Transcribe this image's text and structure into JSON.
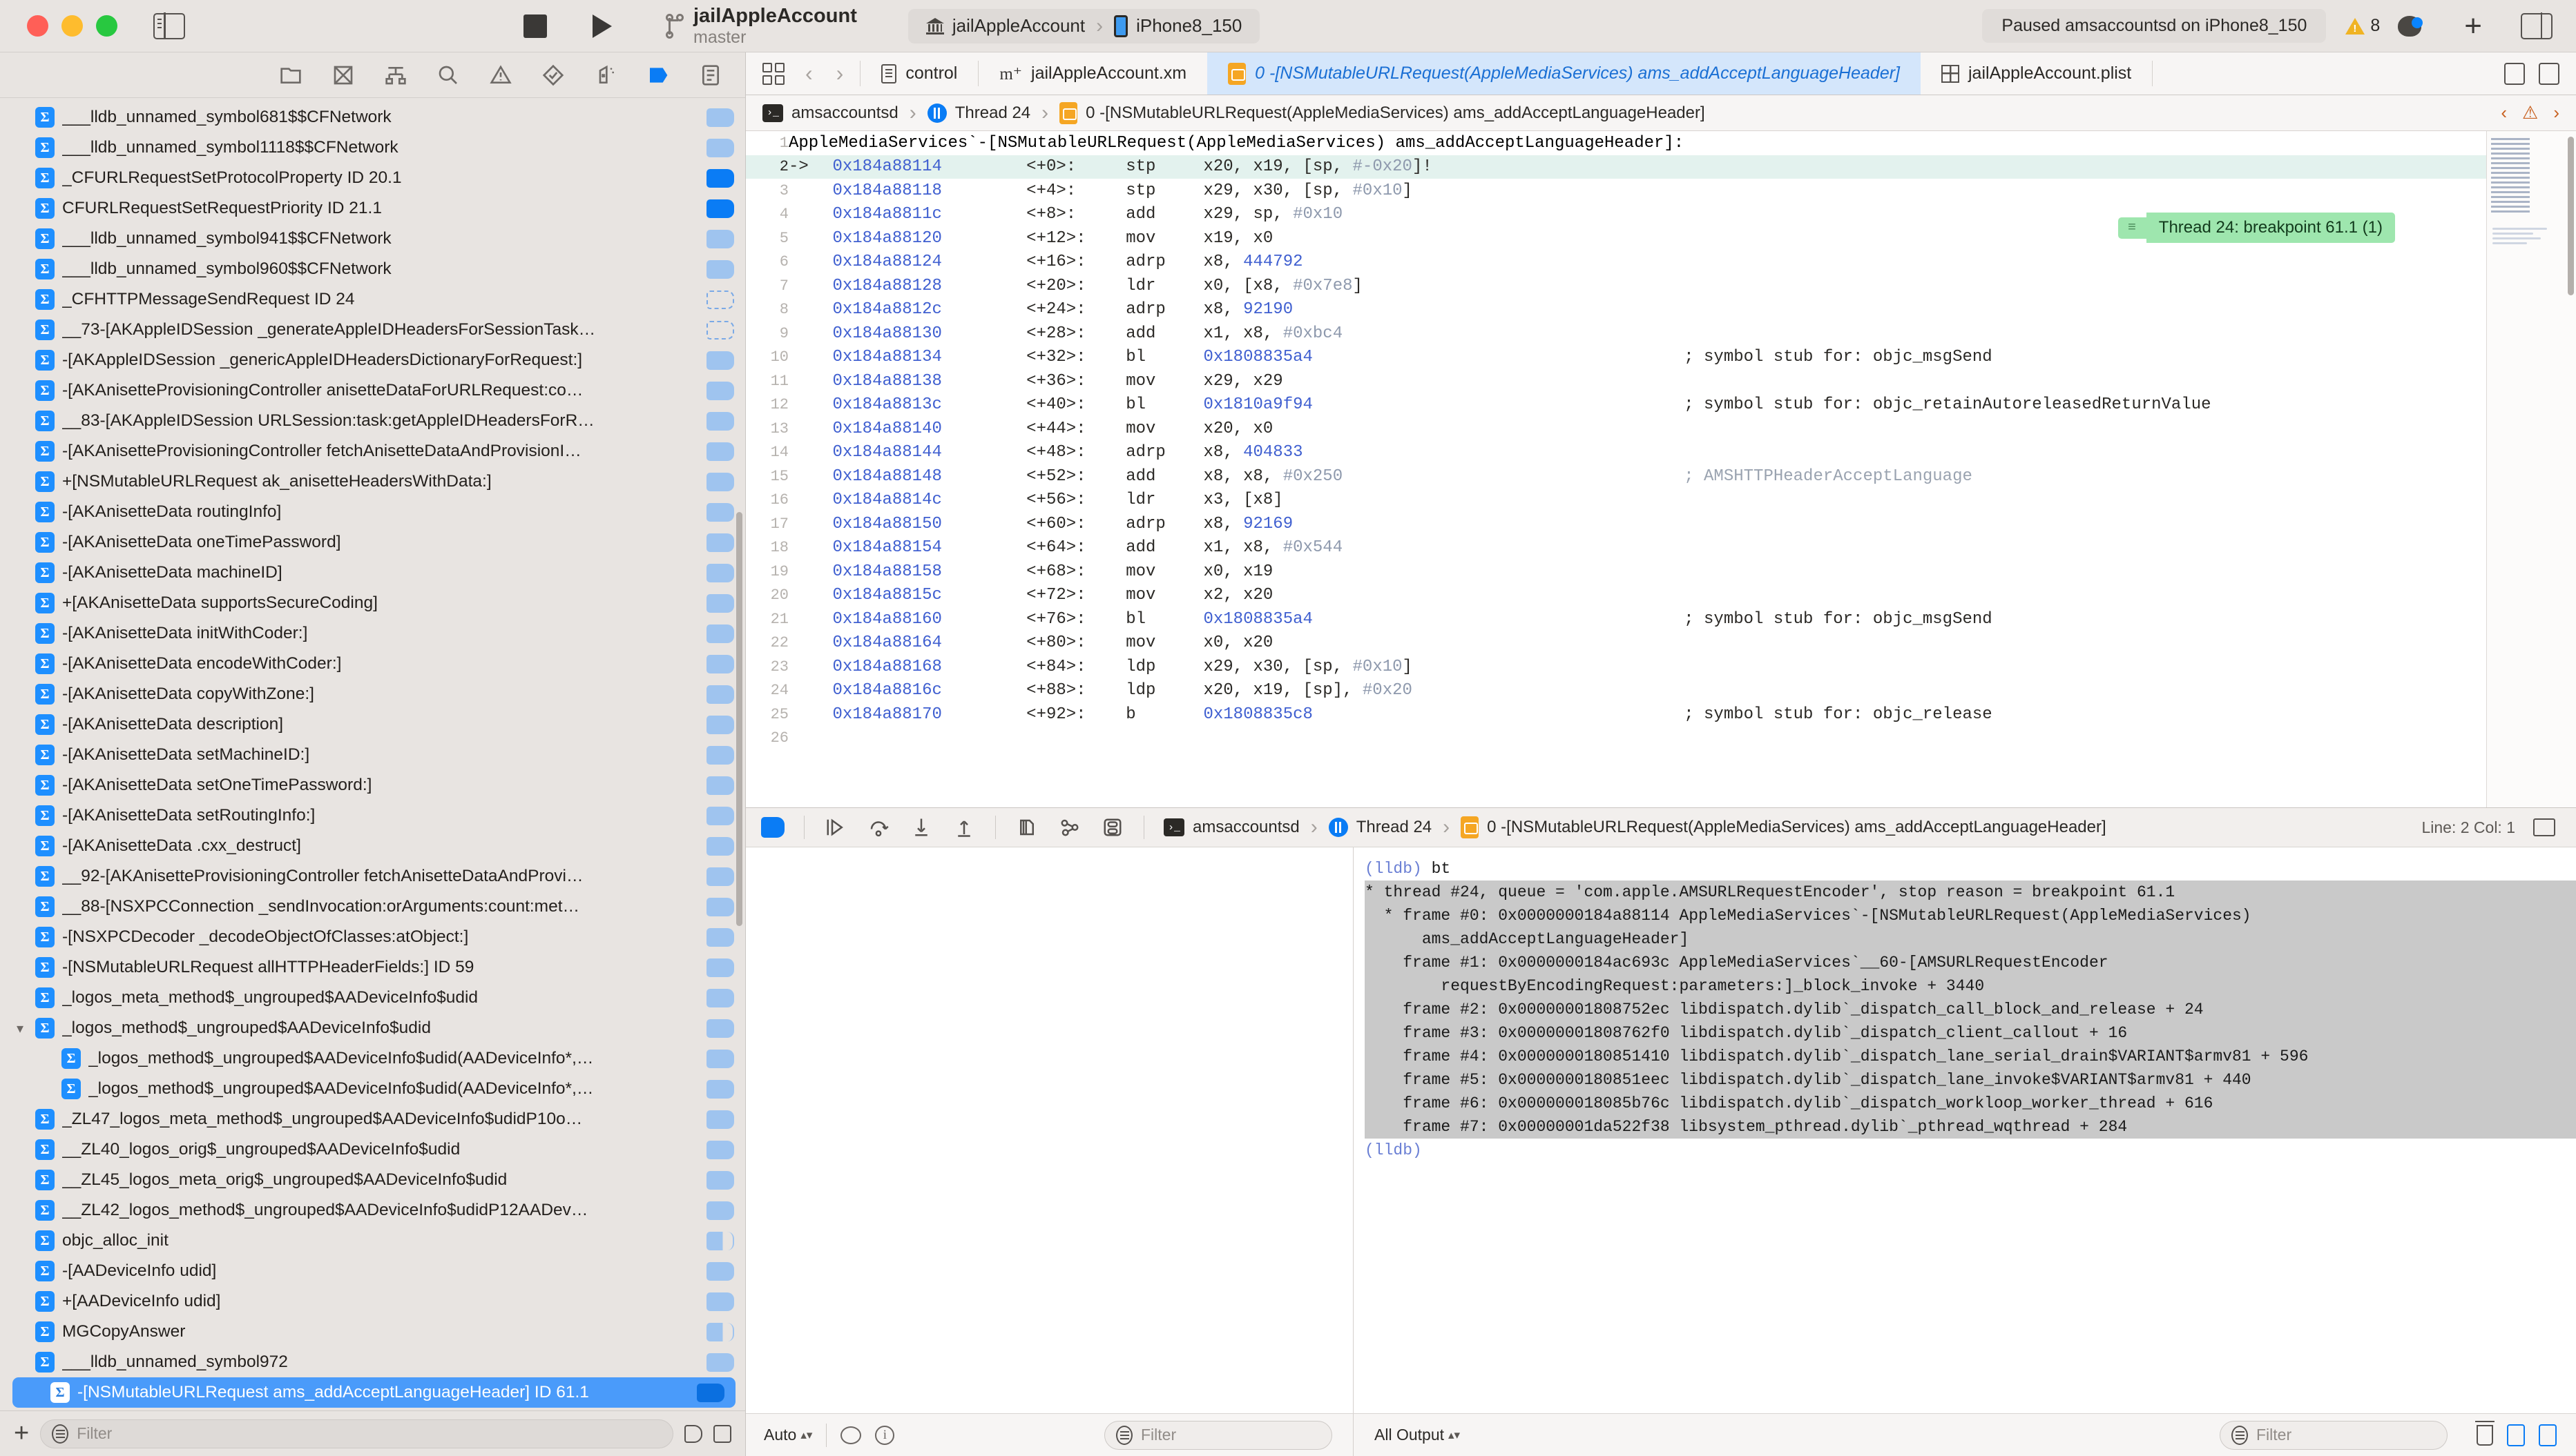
{
  "titlebar": {
    "project_name": "jailAppleAccount",
    "branch": "master",
    "scheme_target": "jailAppleAccount",
    "scheme_device": "iPhone8_150",
    "status": "Paused amsaccountsd on iPhone8_150",
    "warning_count": "8"
  },
  "navigator": {
    "filter_placeholder": "Filter",
    "items": [
      {
        "label": "___lldb_unnamed_symbol681$$CFNetwork",
        "badge": "dim",
        "indent": 0,
        "tri": ""
      },
      {
        "label": "___lldb_unnamed_symbol1118$$CFNetwork",
        "badge": "dim",
        "indent": 0,
        "tri": ""
      },
      {
        "label": "_CFURLRequestSetProtocolProperty  ID 20.1",
        "badge": "on",
        "indent": 0,
        "tri": ""
      },
      {
        "label": "CFURLRequestSetRequestPriority  ID 21.1",
        "badge": "on",
        "indent": 0,
        "tri": ""
      },
      {
        "label": "___lldb_unnamed_symbol941$$CFNetwork",
        "badge": "dim",
        "indent": 0,
        "tri": ""
      },
      {
        "label": "___lldb_unnamed_symbol960$$CFNetwork",
        "badge": "dim",
        "indent": 0,
        "tri": ""
      },
      {
        "label": "_CFHTTPMessageSendRequest ID 24",
        "badge": "off",
        "indent": 0,
        "tri": ""
      },
      {
        "label": "__73-[AKAppleIDSession _generateAppleIDHeadersForSessionTask…",
        "badge": "off",
        "indent": 0,
        "tri": ""
      },
      {
        "label": "-[AKAppleIDSession _genericAppleIDHeadersDictionaryForRequest:]",
        "badge": "dim",
        "indent": 0,
        "tri": ""
      },
      {
        "label": "-[AKAnisetteProvisioningController anisetteDataForURLRequest:co…",
        "badge": "dim",
        "indent": 0,
        "tri": ""
      },
      {
        "label": "__83-[AKAppleIDSession URLSession:task:getAppleIDHeadersForR…",
        "badge": "dim",
        "indent": 0,
        "tri": ""
      },
      {
        "label": "-[AKAnisetteProvisioningController fetchAnisetteDataAndProvisionI…",
        "badge": "dim",
        "indent": 0,
        "tri": ""
      },
      {
        "label": "+[NSMutableURLRequest ak_anisetteHeadersWithData:]",
        "badge": "dim",
        "indent": 0,
        "tri": ""
      },
      {
        "label": "-[AKAnisetteData routingInfo]",
        "badge": "dim",
        "indent": 0,
        "tri": ""
      },
      {
        "label": "-[AKAnisetteData oneTimePassword]",
        "badge": "dim",
        "indent": 0,
        "tri": ""
      },
      {
        "label": "-[AKAnisetteData machineID]",
        "badge": "dim",
        "indent": 0,
        "tri": ""
      },
      {
        "label": "+[AKAnisetteData supportsSecureCoding]",
        "badge": "dim",
        "indent": 0,
        "tri": ""
      },
      {
        "label": "-[AKAnisetteData initWithCoder:]",
        "badge": "dim",
        "indent": 0,
        "tri": ""
      },
      {
        "label": "-[AKAnisetteData encodeWithCoder:]",
        "badge": "dim",
        "indent": 0,
        "tri": ""
      },
      {
        "label": "-[AKAnisetteData copyWithZone:]",
        "badge": "dim",
        "indent": 0,
        "tri": ""
      },
      {
        "label": "-[AKAnisetteData description]",
        "badge": "dim",
        "indent": 0,
        "tri": ""
      },
      {
        "label": "-[AKAnisetteData setMachineID:]",
        "badge": "dim",
        "indent": 0,
        "tri": ""
      },
      {
        "label": "-[AKAnisetteData setOneTimePassword:]",
        "badge": "dim",
        "indent": 0,
        "tri": ""
      },
      {
        "label": "-[AKAnisetteData setRoutingInfo:]",
        "badge": "dim",
        "indent": 0,
        "tri": ""
      },
      {
        "label": "-[AKAnisetteData .cxx_destruct]",
        "badge": "dim",
        "indent": 0,
        "tri": ""
      },
      {
        "label": "__92-[AKAnisetteProvisioningController fetchAnisetteDataAndProvi…",
        "badge": "dim",
        "indent": 0,
        "tri": ""
      },
      {
        "label": "__88-[NSXPCConnection _sendInvocation:orArguments:count:met…",
        "badge": "dim",
        "indent": 0,
        "tri": ""
      },
      {
        "label": "-[NSXPCDecoder _decodeObjectOfClasses:atObject:]",
        "badge": "dim",
        "indent": 0,
        "tri": ""
      },
      {
        "label": "-[NSMutableURLRequest allHTTPHeaderFields:] ID 59",
        "badge": "dim",
        "indent": 0,
        "tri": ""
      },
      {
        "label": "_logos_meta_method$_ungrouped$AADeviceInfo$udid",
        "badge": "dim",
        "indent": 0,
        "tri": ""
      },
      {
        "label": "_logos_method$_ungrouped$AADeviceInfo$udid",
        "badge": "dim",
        "indent": 0,
        "tri": "v"
      },
      {
        "label": "_logos_method$_ungrouped$AADeviceInfo$udid(AADeviceInfo*,…",
        "badge": "dim",
        "indent": 1,
        "tri": ""
      },
      {
        "label": "_logos_method$_ungrouped$AADeviceInfo$udid(AADeviceInfo*,…",
        "badge": "dim",
        "indent": 1,
        "tri": ""
      },
      {
        "label": "_ZL47_logos_meta_method$_ungrouped$AADeviceInfo$udidP10o…",
        "badge": "dim",
        "indent": 0,
        "tri": ""
      },
      {
        "label": "__ZL40_logos_orig$_ungrouped$AADeviceInfo$udid",
        "badge": "dim",
        "indent": 0,
        "tri": ""
      },
      {
        "label": "__ZL45_logos_meta_orig$_ungrouped$AADeviceInfo$udid",
        "badge": "dim",
        "indent": 0,
        "tri": ""
      },
      {
        "label": "__ZL42_logos_method$_ungrouped$AADeviceInfo$udidP12AADev…",
        "badge": "dim",
        "indent": 0,
        "tri": ""
      },
      {
        "label": "objc_alloc_init",
        "badge": "half",
        "indent": 0,
        "tri": ""
      },
      {
        "label": "-[AADeviceInfo udid]",
        "badge": "dim",
        "indent": 0,
        "tri": ""
      },
      {
        "label": "+[AADeviceInfo udid]",
        "badge": "dim",
        "indent": 0,
        "tri": ""
      },
      {
        "label": "MGCopyAnswer",
        "badge": "half",
        "indent": 0,
        "tri": ""
      },
      {
        "label": "___lldb_unnamed_symbol972",
        "badge": "dim",
        "indent": 0,
        "tri": ""
      },
      {
        "label": "-[NSMutableURLRequest ams_addAcceptLanguageHeader]  ID 61.1",
        "badge": "on",
        "indent": 0,
        "tri": "",
        "selected": true
      }
    ]
  },
  "editor": {
    "tabs": [
      {
        "label": "control",
        "icon": "document-icon",
        "active": false
      },
      {
        "label": "jailAppleAccount.xm",
        "icon": "m-file-icon",
        "active": false
      },
      {
        "label": "0 -[NSMutableURLRequest(AppleMediaServices) ams_addAcceptLanguageHeader]",
        "icon": "breakpoint-icon",
        "active": true
      },
      {
        "label": "jailAppleAccount.plist",
        "icon": "plist-icon",
        "active": false
      }
    ],
    "jumpbar": {
      "process": "amsaccountsd",
      "thread": "Thread 24",
      "frame": "0 -[NSMutableURLRequest(AppleMediaServices) ams_addAcceptLanguageHeader]"
    },
    "breakpoint_annotation": "Thread 24: breakpoint 61.1 (1)",
    "header_line": "AppleMediaServices`-[NSMutableURLRequest(AppleMediaServices) ams_addAcceptLanguageHeader]:",
    "lines": [
      {
        "n": "1",
        "header": "AppleMediaServices`-[NSMutableURLRequest(AppleMediaServices) ams_addAcceptLanguageHeader]:"
      },
      {
        "n": "2",
        "arrow": "->",
        "addr": "0x184a88114",
        "off": "<+0>:",
        "mn": "stp",
        "ops": "x20, x19, [sp, #-0x20]!",
        "cur": true
      },
      {
        "n": "3",
        "arrow": "",
        "addr": "0x184a88118",
        "off": "<+4>:",
        "mn": "stp",
        "ops": "x29, x30, [sp, #0x10]"
      },
      {
        "n": "4",
        "arrow": "",
        "addr": "0x184a8811c",
        "off": "<+8>:",
        "mn": "add",
        "ops": "x29, sp, #0x10"
      },
      {
        "n": "5",
        "arrow": "",
        "addr": "0x184a88120",
        "off": "<+12>:",
        "mn": "mov",
        "ops": "x19, x0"
      },
      {
        "n": "6",
        "arrow": "",
        "addr": "0x184a88124",
        "off": "<+16>:",
        "mn": "adrp",
        "ops": "x8, 444792"
      },
      {
        "n": "7",
        "arrow": "",
        "addr": "0x184a88128",
        "off": "<+20>:",
        "mn": "ldr",
        "ops": "x0, [x8, #0x7e8]"
      },
      {
        "n": "8",
        "arrow": "",
        "addr": "0x184a8812c",
        "off": "<+24>:",
        "mn": "adrp",
        "ops": "x8, 92190"
      },
      {
        "n": "9",
        "arrow": "",
        "addr": "0x184a88130",
        "off": "<+28>:",
        "mn": "add",
        "ops": "x1, x8, #0xbc4"
      },
      {
        "n": "10",
        "arrow": "",
        "addr": "0x184a88134",
        "off": "<+32>:",
        "mn": "bl",
        "ops": "0x1808835a4",
        "cmt": "; symbol stub for: objc_msgSend"
      },
      {
        "n": "11",
        "arrow": "",
        "addr": "0x184a88138",
        "off": "<+36>:",
        "mn": "mov",
        "ops": "x29, x29"
      },
      {
        "n": "12",
        "arrow": "",
        "addr": "0x184a8813c",
        "off": "<+40>:",
        "mn": "bl",
        "ops": "0x1810a9f94",
        "cmt": "; symbol stub for: objc_retainAutoreleasedReturnValue"
      },
      {
        "n": "13",
        "arrow": "",
        "addr": "0x184a88140",
        "off": "<+44>:",
        "mn": "mov",
        "ops": "x20, x0"
      },
      {
        "n": "14",
        "arrow": "",
        "addr": "0x184a88144",
        "off": "<+48>:",
        "mn": "adrp",
        "ops": "x8, 404833"
      },
      {
        "n": "15",
        "arrow": "",
        "addr": "0x184a88148",
        "off": "<+52>:",
        "mn": "add",
        "ops": "x8, x8, #0x250",
        "cmt": "; AMSHTTPHeaderAcceptLanguage",
        "cmt_grey": true
      },
      {
        "n": "16",
        "arrow": "",
        "addr": "0x184a8814c",
        "off": "<+56>:",
        "mn": "ldr",
        "ops": "x3, [x8]"
      },
      {
        "n": "17",
        "arrow": "",
        "addr": "0x184a88150",
        "off": "<+60>:",
        "mn": "adrp",
        "ops": "x8, 92169"
      },
      {
        "n": "18",
        "arrow": "",
        "addr": "0x184a88154",
        "off": "<+64>:",
        "mn": "add",
        "ops": "x1, x8, #0x544"
      },
      {
        "n": "19",
        "arrow": "",
        "addr": "0x184a88158",
        "off": "<+68>:",
        "mn": "mov",
        "ops": "x0, x19"
      },
      {
        "n": "20",
        "arrow": "",
        "addr": "0x184a8815c",
        "off": "<+72>:",
        "mn": "mov",
        "ops": "x2, x20"
      },
      {
        "n": "21",
        "arrow": "",
        "addr": "0x184a88160",
        "off": "<+76>:",
        "mn": "bl",
        "ops": "0x1808835a4",
        "cmt": "; symbol stub for: objc_msgSend"
      },
      {
        "n": "22",
        "arrow": "",
        "addr": "0x184a88164",
        "off": "<+80>:",
        "mn": "mov",
        "ops": "x0, x20"
      },
      {
        "n": "23",
        "arrow": "",
        "addr": "0x184a88168",
        "off": "<+84>:",
        "mn": "ldp",
        "ops": "x29, x30, [sp, #0x10]"
      },
      {
        "n": "24",
        "arrow": "",
        "addr": "0x184a8816c",
        "off": "<+88>:",
        "mn": "ldp",
        "ops": "x20, x19, [sp], #0x20"
      },
      {
        "n": "25",
        "arrow": "",
        "addr": "0x184a88170",
        "off": "<+92>:",
        "mn": "b",
        "ops": "0x1808835c8",
        "cmt": "; symbol stub for: objc_release"
      },
      {
        "n": "26",
        "arrow": "",
        "addr": "",
        "off": "",
        "mn": "",
        "ops": ""
      }
    ]
  },
  "debug": {
    "bar": {
      "process": "amsaccountsd",
      "thread": "Thread 24",
      "frame": "0 -[NSMutableURLRequest(AppleMediaServices) ams_addAcceptLanguageHeader]",
      "linecol": "Line: 2  Col: 1"
    },
    "console": [
      {
        "text": "(lldb) bt",
        "prompt": true
      },
      {
        "text": "* thread #24, queue = 'com.apple.AMSURLRequestEncoder', stop reason = breakpoint 61.1",
        "sel": true
      },
      {
        "text": "  * frame #0: 0x0000000184a88114 AppleMediaServices`-[NSMutableURLRequest(AppleMediaServices)",
        "sel": true
      },
      {
        "text": "      ams_addAcceptLanguageHeader]",
        "sel": true
      },
      {
        "text": "    frame #1: 0x0000000184ac693c AppleMediaServices`__60-[AMSURLRequestEncoder",
        "sel": true
      },
      {
        "text": "        requestByEncodingRequest:parameters:]_block_invoke + 3440",
        "sel": true
      },
      {
        "text": "    frame #2: 0x00000001808752ec libdispatch.dylib`_dispatch_call_block_and_release + 24",
        "sel": true
      },
      {
        "text": "    frame #3: 0x00000001808762f0 libdispatch.dylib`_dispatch_client_callout + 16",
        "sel": true
      },
      {
        "text": "    frame #4: 0x0000000180851410 libdispatch.dylib`_dispatch_lane_serial_drain$VARIANT$armv81 + 596",
        "sel": true
      },
      {
        "text": "    frame #5: 0x0000000180851eec libdispatch.dylib`_dispatch_lane_invoke$VARIANT$armv81 + 440",
        "sel": true
      },
      {
        "text": "    frame #6: 0x000000018085b76c libdispatch.dylib`_dispatch_workloop_worker_thread + 616",
        "sel": true
      },
      {
        "text": "    frame #7: 0x00000001da522f38 libsystem_pthread.dylib`_pthread_wqthread + 284",
        "sel": true
      },
      {
        "text": "(lldb)",
        "prompt": true
      }
    ],
    "footer": {
      "scope_popup": "Auto",
      "variables_filter_placeholder": "Filter",
      "output_popup": "All Output",
      "console_filter_placeholder": "Filter"
    }
  }
}
